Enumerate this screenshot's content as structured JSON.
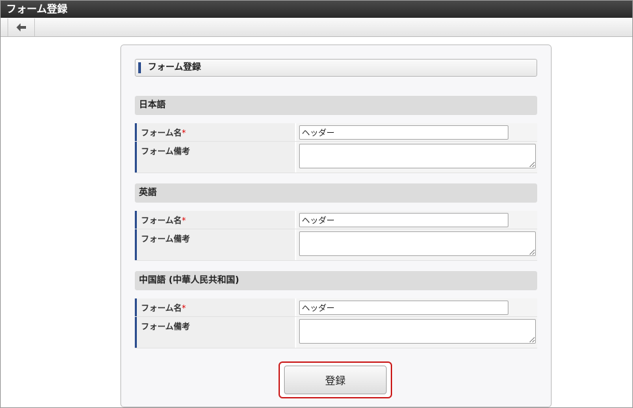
{
  "window": {
    "title": "フォーム登録"
  },
  "toolbar": {
    "back_icon": "arrow-left-icon"
  },
  "panel": {
    "header": "フォーム登録",
    "sections": [
      {
        "title": "日本語",
        "name_label": "フォーム名",
        "required_mark": "*",
        "name_value": "ヘッダー",
        "note_label": "フォーム備考",
        "note_value": ""
      },
      {
        "title": "英語",
        "name_label": "フォーム名",
        "required_mark": "*",
        "name_value": "ヘッダー",
        "note_label": "フォーム備考",
        "note_value": ""
      },
      {
        "title": "中国語 (中華人民共和国)",
        "name_label": "フォーム名",
        "required_mark": "*",
        "name_value": "ヘッダー",
        "note_label": "フォーム備考",
        "note_value": ""
      }
    ],
    "submit_label": "登録"
  },
  "colors": {
    "accent": "#2e4f8f",
    "highlight": "#cc1f1f",
    "required": "#dd0000"
  }
}
